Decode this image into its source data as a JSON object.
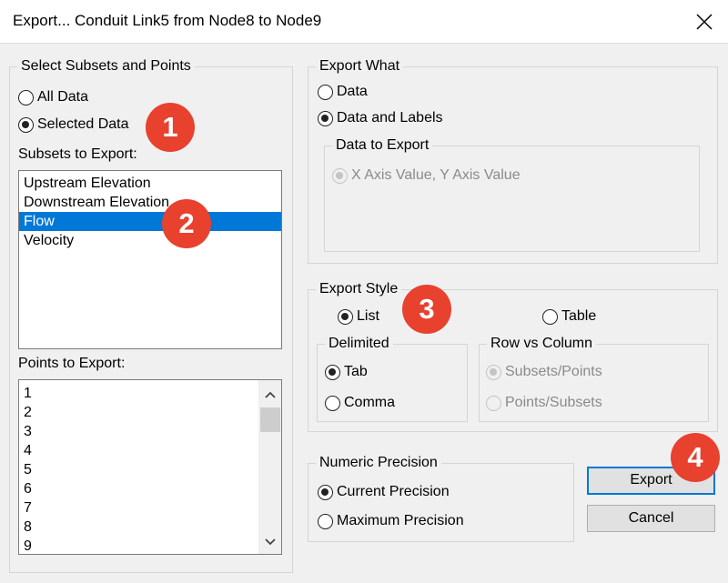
{
  "window": {
    "title": "Export... Conduit Link5 from Node8 to Node9"
  },
  "select_subsets": {
    "legend": "Select Subsets and Points",
    "all_data": "All Data",
    "selected_data": "Selected Data",
    "subsets_label": "Subsets to Export:",
    "subsets": [
      "Upstream Elevation",
      "Downstream Elevation",
      "Flow",
      "Velocity"
    ],
    "selected_subset": "Flow",
    "points_label": "Points to Export:",
    "points": [
      "1",
      "2",
      "3",
      "4",
      "5",
      "6",
      "7",
      "8",
      "9"
    ]
  },
  "export_what": {
    "legend": "Export What",
    "data": "Data",
    "data_and_labels": "Data and Labels",
    "data_to_export_legend": "Data to Export",
    "xy_value": "X Axis Value, Y Axis Value"
  },
  "export_style": {
    "legend": "Export Style",
    "list": "List",
    "table": "Table",
    "delimited_legend": "Delimited",
    "tab": "Tab",
    "comma": "Comma",
    "row_vs_column_legend": "Row vs Column",
    "subsets_points": "Subsets/Points",
    "points_subsets": "Points/Subsets"
  },
  "numeric_precision": {
    "legend": "Numeric Precision",
    "current": "Current Precision",
    "maximum": "Maximum Precision"
  },
  "buttons": {
    "export": "Export",
    "cancel": "Cancel"
  },
  "badges": [
    "1",
    "2",
    "3",
    "4"
  ],
  "colors": {
    "badge": "#e8412e",
    "selection": "#0078d7",
    "default_button_border": "#0078d7"
  },
  "icons": {
    "close": "close-icon",
    "scroll_up": "chevron-up-icon",
    "scroll_down": "chevron-down-icon"
  }
}
